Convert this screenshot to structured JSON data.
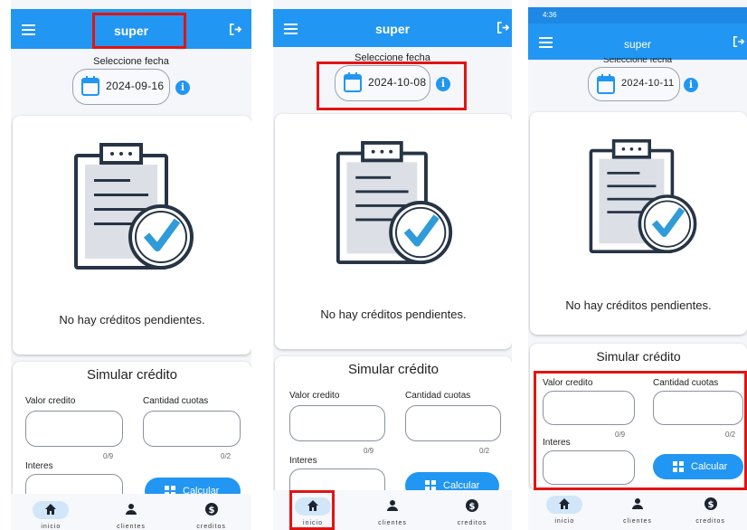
{
  "app": {
    "title": "super"
  },
  "date_picker": {
    "label": "Seleccione fecha"
  },
  "panels": [
    {
      "date": "2024-09-16"
    },
    {
      "date": "2024-10-08"
    },
    {
      "date": "2024-10-11",
      "status_time": "4:36"
    }
  ],
  "empty_state": {
    "message": "No hay créditos pendientes."
  },
  "simulator": {
    "title": "Simular crédito",
    "amount_label": "Valor credito",
    "amount_counter": "0/9",
    "installments_label": "Cantidad cuotas",
    "installments_counter": "0/2",
    "interest_label": "Interes",
    "calculate_label": "Calcular"
  },
  "nav": {
    "home": "inicio",
    "clients": "clientes",
    "credits": "creditos"
  },
  "colors": {
    "primary": "#2196f3",
    "highlight": "#e11414",
    "icon_dark": "#263445",
    "check": "#2f9bd8"
  },
  "icons": [
    "menu-icon",
    "logout-icon",
    "calendar-icon",
    "info-icon",
    "clipboard-check-icon",
    "calculator-icon",
    "home-icon",
    "person-icon",
    "dollar-icon"
  ]
}
